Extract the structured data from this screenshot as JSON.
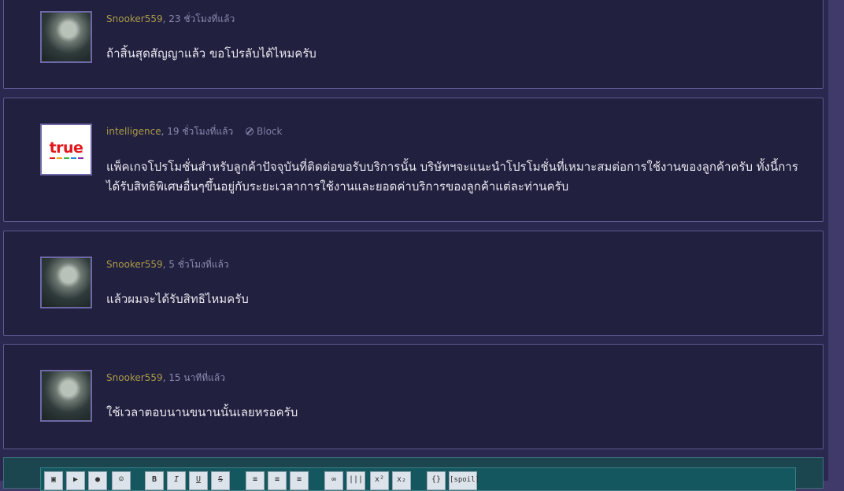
{
  "posts": [
    {
      "author": "Snooker559",
      "time": "23 ชั่วโมงที่แล้ว",
      "message": "ถ้าสิ้นสุดสัญญาแล้ว ขอโปรลับได้ไหมครับ",
      "avatar": "photo"
    },
    {
      "author": "intelligence",
      "time": "19 ชั่วโมงที่แล้ว",
      "block_label": "Block",
      "message": "แพ็คเกจโปรโมชั่นสำหรับลูกค้าปัจจุบันที่ติดต่อขอรับบริการนั้น บริษัทฯจะแนะนำโปรโมชั่นที่เหมาะสมต่อการใช้งานของลูกค้าครับ ทั้งนี้การได้รับสิทธิพิเศษอื่นๆขึ้นอยู่กับระยะเวลาการใช้งานและยอดค่าบริการของลูกค้าแต่ละท่านครับ",
      "avatar": "true-logo",
      "logo_text": "true"
    },
    {
      "author": "Snooker559",
      "time": "5 ชั่วโมงที่แล้ว",
      "message": "แล้วผมจะได้รับสิทธิไหมครับ",
      "avatar": "photo"
    },
    {
      "author": "Snooker559",
      "time": "15 นาทีที่แล้ว",
      "message": "ใช้เวลาตอบนานขนานนั้นเลยหรอครับ",
      "avatar": "photo"
    }
  ],
  "separator": ", ",
  "toolbar": {
    "buttons": [
      "image-icon",
      "video-icon",
      "location-icon",
      "emoji-icon",
      "B",
      "I",
      "U",
      "S",
      "align-left-icon",
      "align-center-icon",
      "align-right-icon",
      "link-icon",
      "barcode-icon",
      "x²",
      "x₂",
      "{}",
      "[spoil]"
    ]
  },
  "colors": {
    "author": "#a89a48",
    "card_bg": "#22203f",
    "card_border": "#5c5890",
    "text": "#e6e6ee"
  }
}
